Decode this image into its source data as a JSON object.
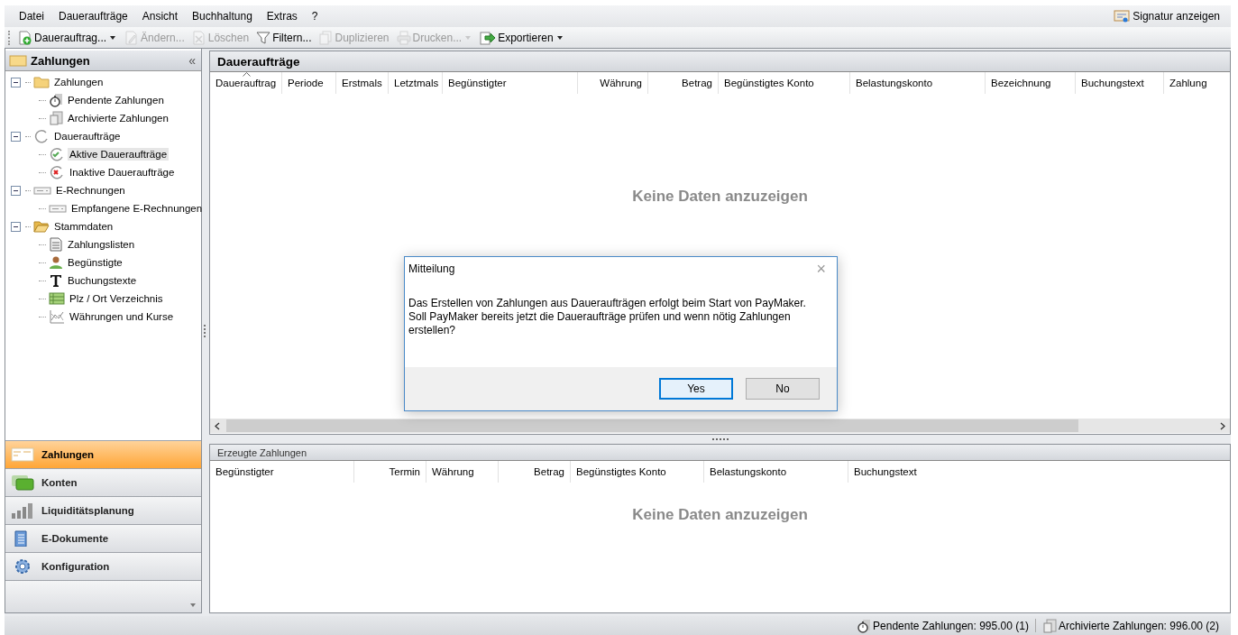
{
  "menu": [
    {
      "label": "Datei"
    },
    {
      "label": "Daueraufträge"
    },
    {
      "label": "Ansicht"
    },
    {
      "label": "Buchhaltung"
    },
    {
      "label": "Extras"
    },
    {
      "label": "?"
    }
  ],
  "menu_right": {
    "label": "Signatur anzeigen"
  },
  "toolbar": [
    {
      "label": "Dauerauftrag...",
      "disabled": false,
      "dropdown": true
    },
    {
      "label": "Ändern...",
      "disabled": true,
      "dropdown": false
    },
    {
      "label": "Löschen",
      "disabled": true,
      "dropdown": false
    },
    {
      "label": "Filtern...",
      "disabled": false,
      "dropdown": false
    },
    {
      "label": "Duplizieren",
      "disabled": true,
      "dropdown": false
    },
    {
      "label": "Drucken...",
      "disabled": true,
      "dropdown": true
    },
    {
      "label": "Exportieren",
      "disabled": false,
      "dropdown": true
    }
  ],
  "sidebar": {
    "title": "Zahlungen",
    "collapse": "«",
    "tree": [
      {
        "label": "Zahlungen",
        "expanded": true,
        "selected": false,
        "children": [
          {
            "label": "Pendente Zahlungen",
            "selected": false
          },
          {
            "label": "Archivierte Zahlungen",
            "selected": false
          }
        ]
      },
      {
        "label": "Daueraufträge",
        "expanded": true,
        "selected": false,
        "children": [
          {
            "label": "Aktive Daueraufträge",
            "selected": true
          },
          {
            "label": "Inaktive Daueraufträge",
            "selected": false
          }
        ]
      },
      {
        "label": "E-Rechnungen",
        "expanded": true,
        "selected": false,
        "children": [
          {
            "label": "Empfangene E-Rechnungen",
            "selected": false
          }
        ]
      },
      {
        "label": "Stammdaten",
        "expanded": true,
        "selected": false,
        "children": [
          {
            "label": "Zahlungslisten",
            "selected": false
          },
          {
            "label": "Begünstigte",
            "selected": false
          },
          {
            "label": "Buchungstexte",
            "selected": false
          },
          {
            "label": "Plz / Ort Verzeichnis",
            "selected": false
          },
          {
            "label": "Währungen und Kurse",
            "selected": false
          }
        ]
      }
    ],
    "sections": [
      {
        "label": "Zahlungen",
        "selected": true
      },
      {
        "label": "Konten",
        "selected": false
      },
      {
        "label": "Liquiditätsplanung",
        "selected": false
      },
      {
        "label": "E-Dokumente",
        "selected": false
      },
      {
        "label": "Konfiguration",
        "selected": false
      }
    ]
  },
  "panels": [
    {
      "title": "Daueraufträge",
      "kind": "main",
      "empty_text": "Keine Daten anzuzeigen",
      "columns": [
        {
          "label": "Dauerauftrag",
          "sorted": true
        },
        {
          "label": "Periode",
          "sorted": false
        },
        {
          "label": "Erstmals",
          "sorted": false
        },
        {
          "label": "Letztmals",
          "sorted": false
        },
        {
          "label": "Begünstigter",
          "sorted": false
        },
        {
          "label": "Währung",
          "sorted": false
        },
        {
          "label": "Betrag",
          "sorted": false
        },
        {
          "label": "Begünstigtes Konto",
          "sorted": false
        },
        {
          "label": "Belastungskonto",
          "sorted": false
        },
        {
          "label": "Bezeichnung",
          "sorted": false
        },
        {
          "label": "Buchungstext",
          "sorted": false
        },
        {
          "label": "Zahlung",
          "sorted": false
        }
      ]
    },
    {
      "title": "Erzeugte Zahlungen",
      "kind": "sub",
      "empty_text": "Keine Daten anzuzeigen",
      "columns": [
        {
          "label": "Begünstigter",
          "sorted": false
        },
        {
          "label": "Termin",
          "sorted": false
        },
        {
          "label": "Währung",
          "sorted": false
        },
        {
          "label": "Betrag",
          "sorted": false
        },
        {
          "label": "Begünstigtes Konto",
          "sorted": false
        },
        {
          "label": "Belastungskonto",
          "sorted": false
        },
        {
          "label": "Buchungstext",
          "sorted": false
        }
      ]
    }
  ],
  "dialog": {
    "title": "Mitteilung",
    "close": "×",
    "message": "Das Erstellen von Zahlungen aus Daueraufträgen erfolgt beim Start von PayMaker.\nSoll PayMaker bereits jetzt die Daueraufträge prüfen und wenn nötig Zahlungen\nerstellen?",
    "buttons": [
      {
        "label": "Yes",
        "focused": true
      },
      {
        "label": "No",
        "focused": false
      }
    ]
  },
  "status_bar": [
    {
      "label": "Pendente Zahlungen: 995.00 (1)"
    },
    {
      "label": "Archivierte Zahlungen: 996.00 (2)"
    }
  ]
}
